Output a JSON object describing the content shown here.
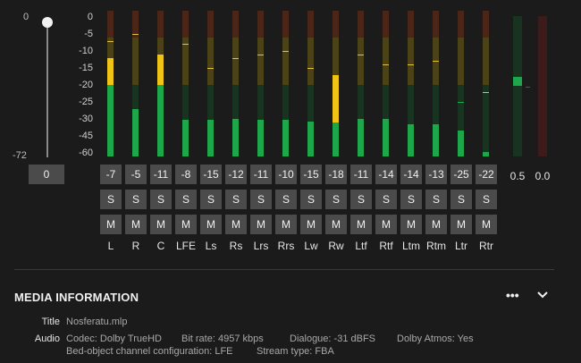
{
  "master_fader": {
    "top_label": "0",
    "bottom_label": "-72",
    "value": "0",
    "level": 1.0
  },
  "scale_labels": [
    "0",
    "-5",
    "-10",
    "-15",
    "-20",
    "-25",
    "-30",
    "-45",
    "-60"
  ],
  "channels": [
    {
      "name": "L",
      "value": "-7",
      "solo": "S",
      "mute": "M"
    },
    {
      "name": "R",
      "value": "-5",
      "solo": "S",
      "mute": "M"
    },
    {
      "name": "C",
      "value": "-11",
      "solo": "S",
      "mute": "M"
    },
    {
      "name": "LFE",
      "value": "-8",
      "solo": "S",
      "mute": "M"
    },
    {
      "name": "Ls",
      "value": "-15",
      "solo": "S",
      "mute": "M"
    },
    {
      "name": "Rs",
      "value": "-12",
      "solo": "S",
      "mute": "M"
    },
    {
      "name": "Lrs",
      "value": "-11",
      "solo": "S",
      "mute": "M"
    },
    {
      "name": "Rrs",
      "value": "-10",
      "solo": "S",
      "mute": "M"
    },
    {
      "name": "Lw",
      "value": "-15",
      "solo": "S",
      "mute": "M"
    },
    {
      "name": "Rw",
      "value": "-18",
      "solo": "S",
      "mute": "M"
    },
    {
      "name": "Ltf",
      "value": "-11",
      "solo": "S",
      "mute": "M"
    },
    {
      "name": "Rtf",
      "value": "-14",
      "solo": "S",
      "mute": "M"
    },
    {
      "name": "Ltm",
      "value": "-14",
      "solo": "S",
      "mute": "M"
    },
    {
      "name": "Rtm",
      "value": "-13",
      "solo": "S",
      "mute": "M"
    },
    {
      "name": "Ltr",
      "value": "-25",
      "solo": "S",
      "mute": "M"
    },
    {
      "name": "Rtr",
      "value": "-22",
      "solo": "S",
      "mute": "M"
    }
  ],
  "meter_levels_db": [
    -20,
    -27,
    -20,
    -31,
    -31,
    -30,
    -31,
    -31,
    -32,
    -33,
    -30,
    -30,
    -35,
    -35,
    -40,
    -59
  ],
  "meter_peaks_db": [
    -7,
    -5,
    -11,
    -8,
    -15,
    -12,
    -11,
    -10,
    -15,
    -18,
    -11,
    -14,
    -14,
    -13,
    -25,
    -22
  ],
  "meter_hold_db": [
    -12,
    null,
    -11,
    null,
    null,
    null,
    null,
    null,
    null,
    -17,
    null,
    null,
    null,
    null,
    null,
    null
  ],
  "loudness": [
    {
      "value": "0.5",
      "color": "#18331f",
      "fill_color": "#1ea64a"
    },
    {
      "value": "0.0",
      "color": "#3d1b1b",
      "fill_color": "#a33"
    }
  ],
  "colors": {
    "accent_green": "#1ea64a",
    "accent_yellow": "#f0c414"
  },
  "media": {
    "heading": "MEDIA INFORMATION",
    "more_icon": "•••",
    "title_key": "Title",
    "title_value": "Nosferatu.mlp",
    "audio_key": "Audio",
    "codec": "Codec: Dolby TrueHD",
    "bitrate": "Bit rate: 4957 kbps",
    "dialogue": "Dialogue: -31 dBFS",
    "atmos": "Dolby Atmos: Yes",
    "bed_config": "Bed-object channel configuration: LFE",
    "stream_type": "Stream type: FBA"
  }
}
